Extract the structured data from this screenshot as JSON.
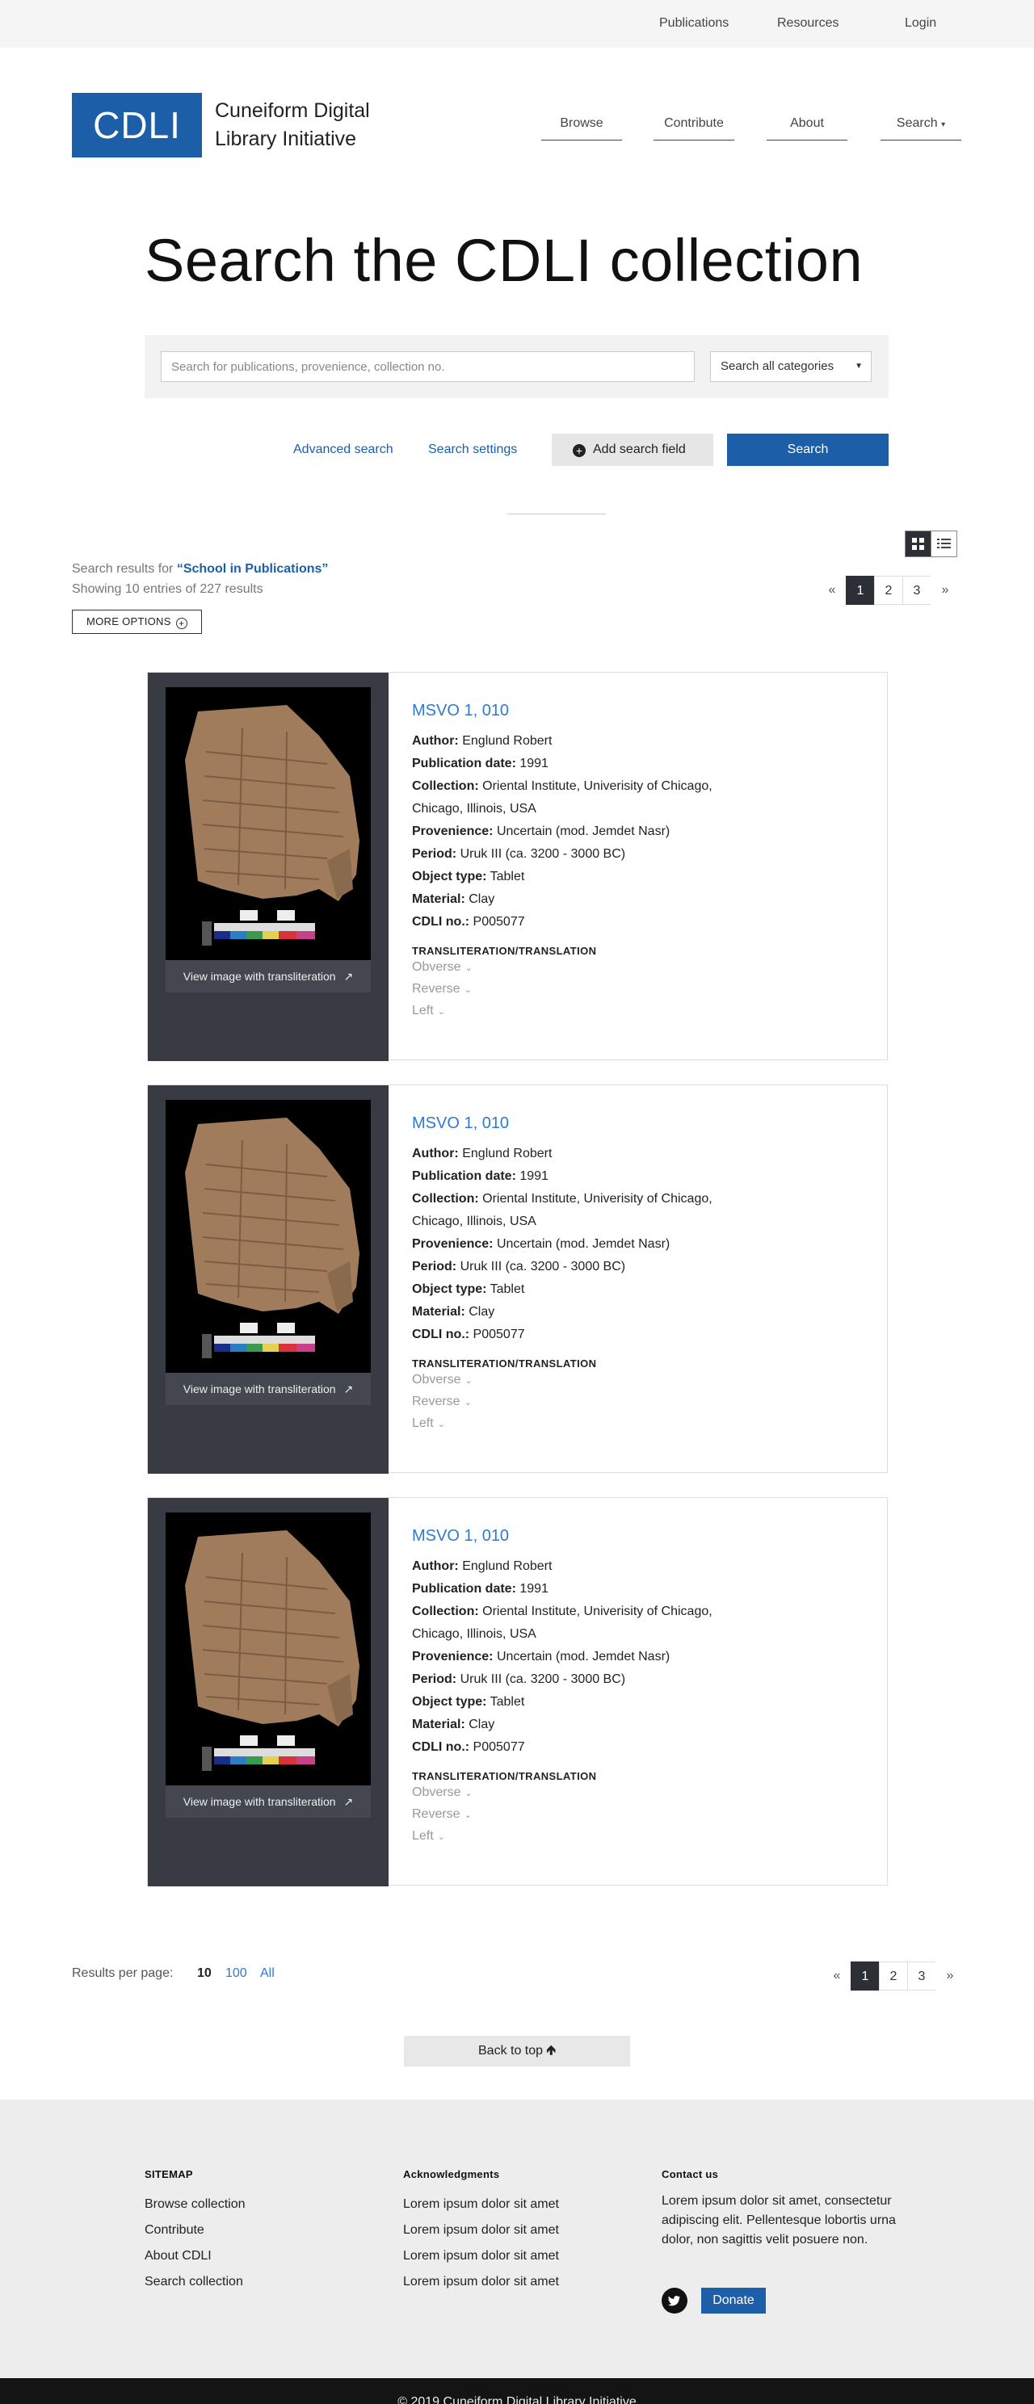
{
  "topbar": {
    "publications": "Publications",
    "resources": "Resources",
    "login": "Login"
  },
  "header": {
    "logo": "CDLI",
    "site_name_line1": "Cuneiform Digital",
    "site_name_line2": "Library Initiative",
    "nav": {
      "browse": "Browse",
      "contribute": "Contribute",
      "about": "About",
      "search": "Search"
    }
  },
  "page_title": "Search the CDLI collection",
  "search": {
    "placeholder": "Search for publications, provenience, collection no.",
    "category": "Search all categories",
    "advanced": "Advanced search",
    "settings": "Search settings",
    "add_field": "Add search field",
    "submit": "Search"
  },
  "results": {
    "prefix": "Search results for ",
    "query": "“School in Publications”",
    "showing": "Showing 10 entries of 227 results",
    "more_options": "MORE OPTIONS"
  },
  "pagination": {
    "prev": "«",
    "pages": [
      "1",
      "2",
      "3"
    ],
    "next": "»",
    "active": "1"
  },
  "cards": [
    {
      "title": "MSVO 1, 010",
      "author": "Englund Robert",
      "publication_date": "1991",
      "collection_1": "Oriental Institute, Univerisity of Chicago,",
      "collection_2": "Chicago, Illinois, USA",
      "provenience": "Uncertain (mod. Jemdet Nasr)",
      "period": "Uruk III (ca. 3200 - 3000 BC)",
      "object_type": "Tablet",
      "material": "Clay",
      "cdli_no": "P005077"
    },
    {
      "title": "MSVO 1, 010",
      "author": "Englund Robert",
      "publication_date": "1991",
      "collection_1": "Oriental Institute, Univerisity of Chicago,",
      "collection_2": "Chicago, Illinois, USA",
      "provenience": "Uncertain (mod. Jemdet Nasr)",
      "period": "Uruk III (ca. 3200 - 3000 BC)",
      "object_type": "Tablet",
      "material": "Clay",
      "cdli_no": "P005077"
    },
    {
      "title": "MSVO 1, 010",
      "author": "Englund Robert",
      "publication_date": "1991",
      "collection_1": "Oriental Institute, Univerisity of Chicago,",
      "collection_2": "Chicago, Illinois, USA",
      "provenience": "Uncertain (mod. Jemdet Nasr)",
      "period": "Uruk III (ca. 3200 - 3000 BC)",
      "object_type": "Tablet",
      "material": "Clay",
      "cdli_no": "P005077"
    }
  ],
  "card_labels": {
    "author": "Author:",
    "publication_date": "Publication date:",
    "collection": "Collection:",
    "provenience": "Provenience:",
    "period": "Period:",
    "object_type": "Object type:",
    "material": "Material:",
    "cdli_no": "CDLI no.:",
    "view_image": "View image with transliteration",
    "translit_heading": "TRANSLITERATION/TRANSLATION",
    "obverse": "Obverse",
    "reverse": "Reverse",
    "left": "Left"
  },
  "results_per_page": {
    "label": "Results per page:",
    "options": [
      "10",
      "100",
      "All"
    ],
    "selected": "10"
  },
  "back_to_top": "Back to top",
  "footer": {
    "sitemap_heading": "SITEMAP",
    "sitemap": [
      "Browse collection",
      "Contribute",
      "About CDLI",
      "Search collection"
    ],
    "ack_heading": "Acknowledgments",
    "ack": [
      "Lorem ipsum dolor sit amet",
      "Lorem ipsum dolor sit amet",
      "Lorem ipsum dolor sit amet",
      "Lorem ipsum dolor sit amet"
    ],
    "contact_heading": "Contact us",
    "contact_text": "Lorem ipsum dolor sit amet, consectetur adipiscing elit. Pellentesque lobortis urna dolor, non sagittis velit posuere non.",
    "donate": "Donate",
    "copyright": "© 2019 Cuneiform Digital Library Initiative"
  },
  "colors": {
    "brand": "#1d5ea9",
    "link": "#2f7ad1",
    "dark_panel": "#383b43"
  }
}
